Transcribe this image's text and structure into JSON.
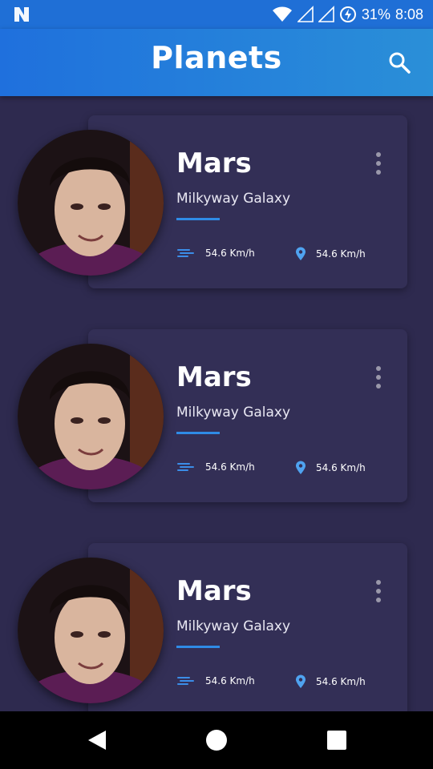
{
  "status_bar": {
    "battery_percent": "31%",
    "time": "8:08",
    "icons": [
      "n-logo-icon",
      "wifi-icon",
      "signal-icon",
      "signal-icon",
      "battery-charging-icon"
    ]
  },
  "app_bar": {
    "title": "Planets",
    "search_icon": "search-icon"
  },
  "colors": {
    "accent": "#2f8be6",
    "app_bar_start": "#1f70dd",
    "app_bar_end": "#2a8fd8",
    "background": "#2e2a4f",
    "card": "#332f56"
  },
  "planets": [
    {
      "name": "Mars",
      "galaxy": "Milkyway Galaxy",
      "wind_speed": "54.6 Km/h",
      "location_value": "54.6 Km/h"
    },
    {
      "name": "Mars",
      "galaxy": "Milkyway Galaxy",
      "wind_speed": "54.6 Km/h",
      "location_value": "54.6 Km/h"
    },
    {
      "name": "Mars",
      "galaxy": "Milkyway Galaxy",
      "wind_speed": "54.6 Km/h",
      "location_value": "54.6 Km/h"
    }
  ],
  "nav_bar": {
    "icons": [
      "back-icon",
      "home-icon",
      "recents-icon"
    ]
  }
}
